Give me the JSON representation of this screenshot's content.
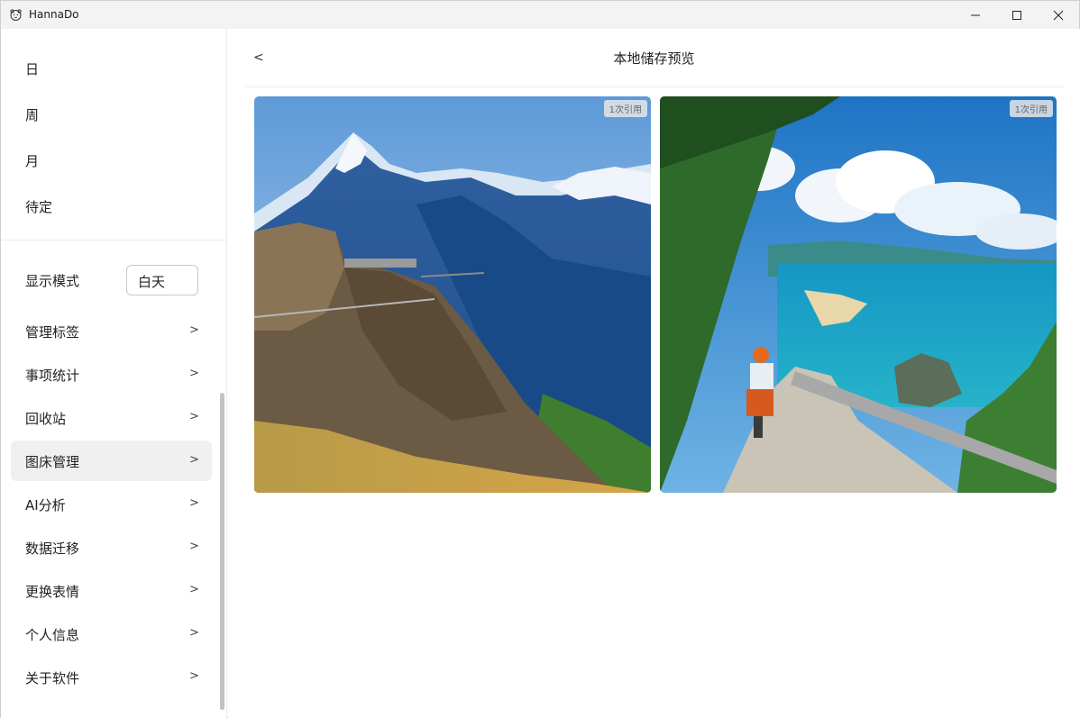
{
  "window": {
    "title": "HannaDo"
  },
  "sidebar": {
    "views": [
      {
        "label": "日"
      },
      {
        "label": "周"
      },
      {
        "label": "月"
      },
      {
        "label": "待定"
      }
    ],
    "display_mode": {
      "label": "显示模式",
      "value": "白天"
    },
    "menu": [
      {
        "label": "管理标签",
        "chevron": ">"
      },
      {
        "label": "事项统计",
        "chevron": ">"
      },
      {
        "label": "回收站",
        "chevron": ">"
      },
      {
        "label": "图床管理",
        "chevron": ">",
        "active": true
      },
      {
        "label": "AI分析",
        "chevron": ">"
      },
      {
        "label": "数据迁移",
        "chevron": ">"
      },
      {
        "label": "更换表情",
        "chevron": ">"
      },
      {
        "label": "个人信息",
        "chevron": ">"
      },
      {
        "label": "关于软件",
        "chevron": ">"
      }
    ]
  },
  "main": {
    "back": "<",
    "title": "本地储存预览",
    "images": [
      {
        "badge": "1次引用",
        "subject": "mountain cliff walkway"
      },
      {
        "badge": "1次引用",
        "subject": "scooter coastal road"
      }
    ]
  },
  "colors": {
    "active_bg": "#f0f0f0",
    "titlebar_bg": "#f3f3f3",
    "divider": "#ececec"
  }
}
